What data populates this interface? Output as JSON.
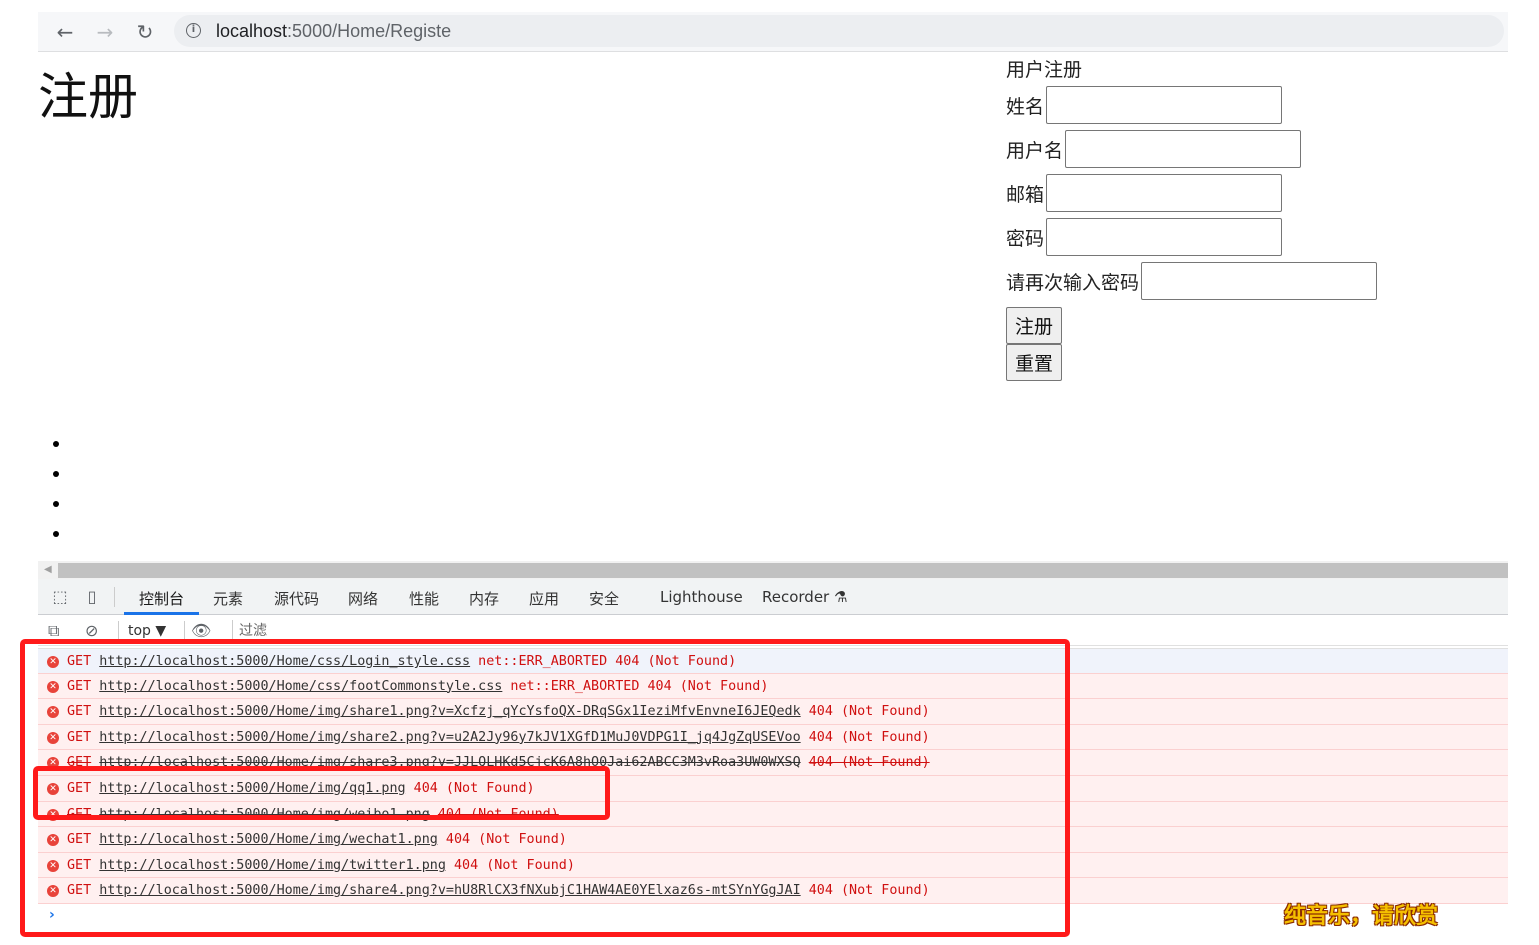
{
  "browser": {
    "url_host": "localhost",
    "url_rest": ":5000/Home/Registe"
  },
  "page": {
    "title": "注册",
    "form": {
      "caption": "用户注册",
      "fields": [
        {
          "label": "姓名",
          "value": ""
        },
        {
          "label": "用户名",
          "value": ""
        },
        {
          "label": "邮箱",
          "value": ""
        },
        {
          "label": "密码",
          "value": ""
        },
        {
          "label": "请再次输入密码",
          "value": ""
        }
      ],
      "submit_label": "注册",
      "reset_label": "重置"
    },
    "bullet_count": 4
  },
  "devtools": {
    "tabs": [
      "控制台",
      "元素",
      "源代码",
      "网络",
      "性能",
      "内存",
      "应用",
      "安全",
      "Lighthouse",
      "Recorder"
    ],
    "active_tab": "控制台",
    "context": "top ▼",
    "filter_placeholder": "过滤",
    "messages": [
      {
        "method": "GET",
        "url": "http://localhost:5000/Home/css/Login_style.css",
        "status": "net::ERR_ABORTED 404 (Not Found)"
      },
      {
        "method": "GET",
        "url": "http://localhost:5000/Home/css/footCommonstyle.css",
        "status": "net::ERR_ABORTED 404 (Not Found)"
      },
      {
        "method": "GET",
        "url": "http://localhost:5000/Home/img/share1.png?v=Xcfzj_qYcYsfoQX-DRqSGx1IeziMfvEnvneI6JEQedk",
        "status": "404 (Not Found)"
      },
      {
        "method": "GET",
        "url": "http://localhost:5000/Home/img/share2.png?v=u2A2Jy96y7kJV1XGfD1MuJ0VDPG1I_jq4JgZqUSEVoo",
        "status": "404 (Not Found)"
      },
      {
        "method": "GET",
        "url": "http://localhost:5000/Home/img/share3.png?v=JJLQLHKd5CjcK6A8hO0Jai62ABCC3M3vRoa3UW0WXSQ",
        "status": "404 (Not Found)"
      },
      {
        "method": "GET",
        "url": "http://localhost:5000/Home/img/qq1.png",
        "status": "404 (Not Found)"
      },
      {
        "method": "GET",
        "url": "http://localhost:5000/Home/img/weibo1.png",
        "status": "404 (Not Found)"
      },
      {
        "method": "GET",
        "url": "http://localhost:5000/Home/img/wechat1.png",
        "status": "404 (Not Found)"
      },
      {
        "method": "GET",
        "url": "http://localhost:5000/Home/img/twitter1.png",
        "status": "404 (Not Found)"
      },
      {
        "method": "GET",
        "url": "http://localhost:5000/Home/img/share4.png?v=hU8RlCX3fNXubjC1HAW4AE0YElxaz6s-mtSYnYGgJAI",
        "status": "404 (Not Found)"
      }
    ]
  },
  "watermark": "纯音乐，请欣赏",
  "colors": {
    "annotation_red": "#ff1a1a",
    "error_red": "#d01010",
    "active_tab_blue": "#1a73e8"
  }
}
